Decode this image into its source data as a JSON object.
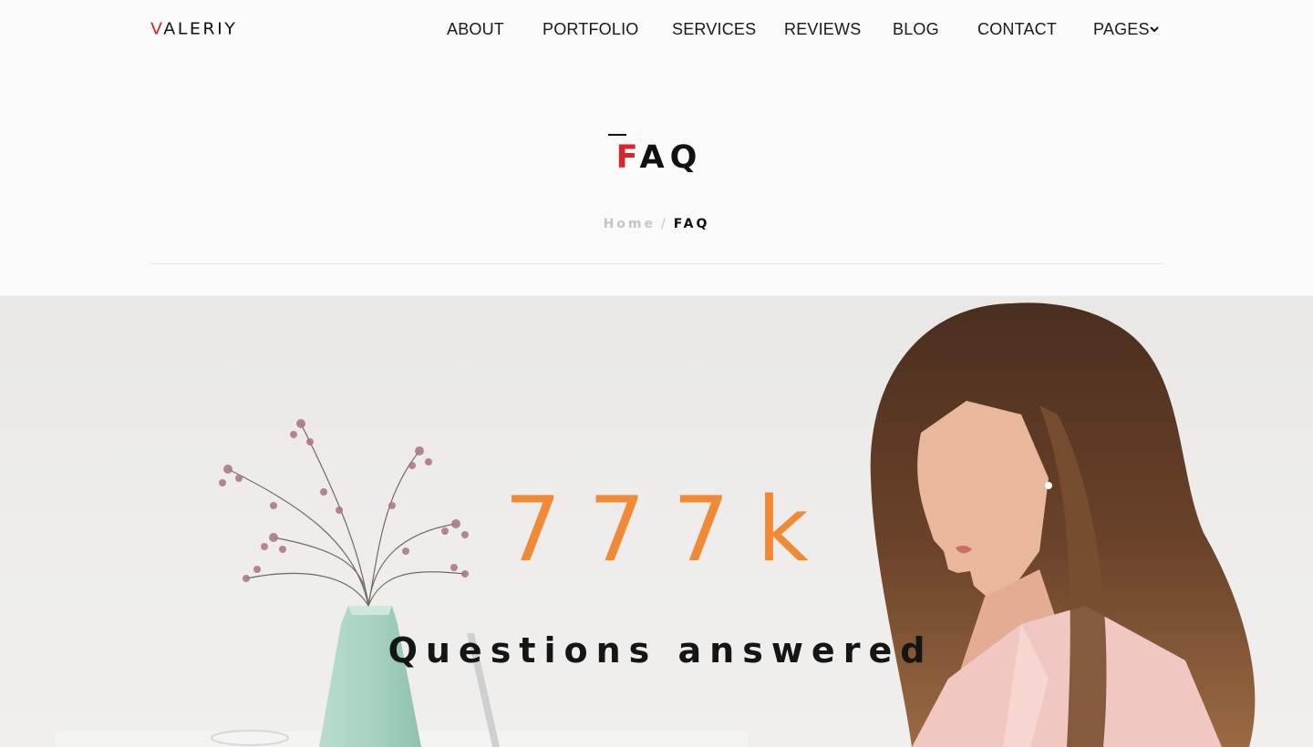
{
  "logo": {
    "accent_letter": "V",
    "rest": "ALERIY"
  },
  "nav": {
    "items": [
      "ABOUT",
      "PORTFOLIO",
      "SERVICES",
      "REVIEWS",
      "BLOG",
      "CONTACT",
      "PAGES"
    ],
    "dropdown_icon": "chevron-down-icon"
  },
  "page": {
    "title_first": "F",
    "title_rest": "AQ",
    "breadcrumb": {
      "home": "Home",
      "separator": "/",
      "current": "FAQ"
    }
  },
  "hero": {
    "stat_number": "777k",
    "stat_label": "Questions answered"
  },
  "colors": {
    "accent_red": "#d4262c",
    "stat_orange": "#f08a36",
    "text_dark": "#111111",
    "breadcrumb_muted": "#c5c5c5"
  }
}
